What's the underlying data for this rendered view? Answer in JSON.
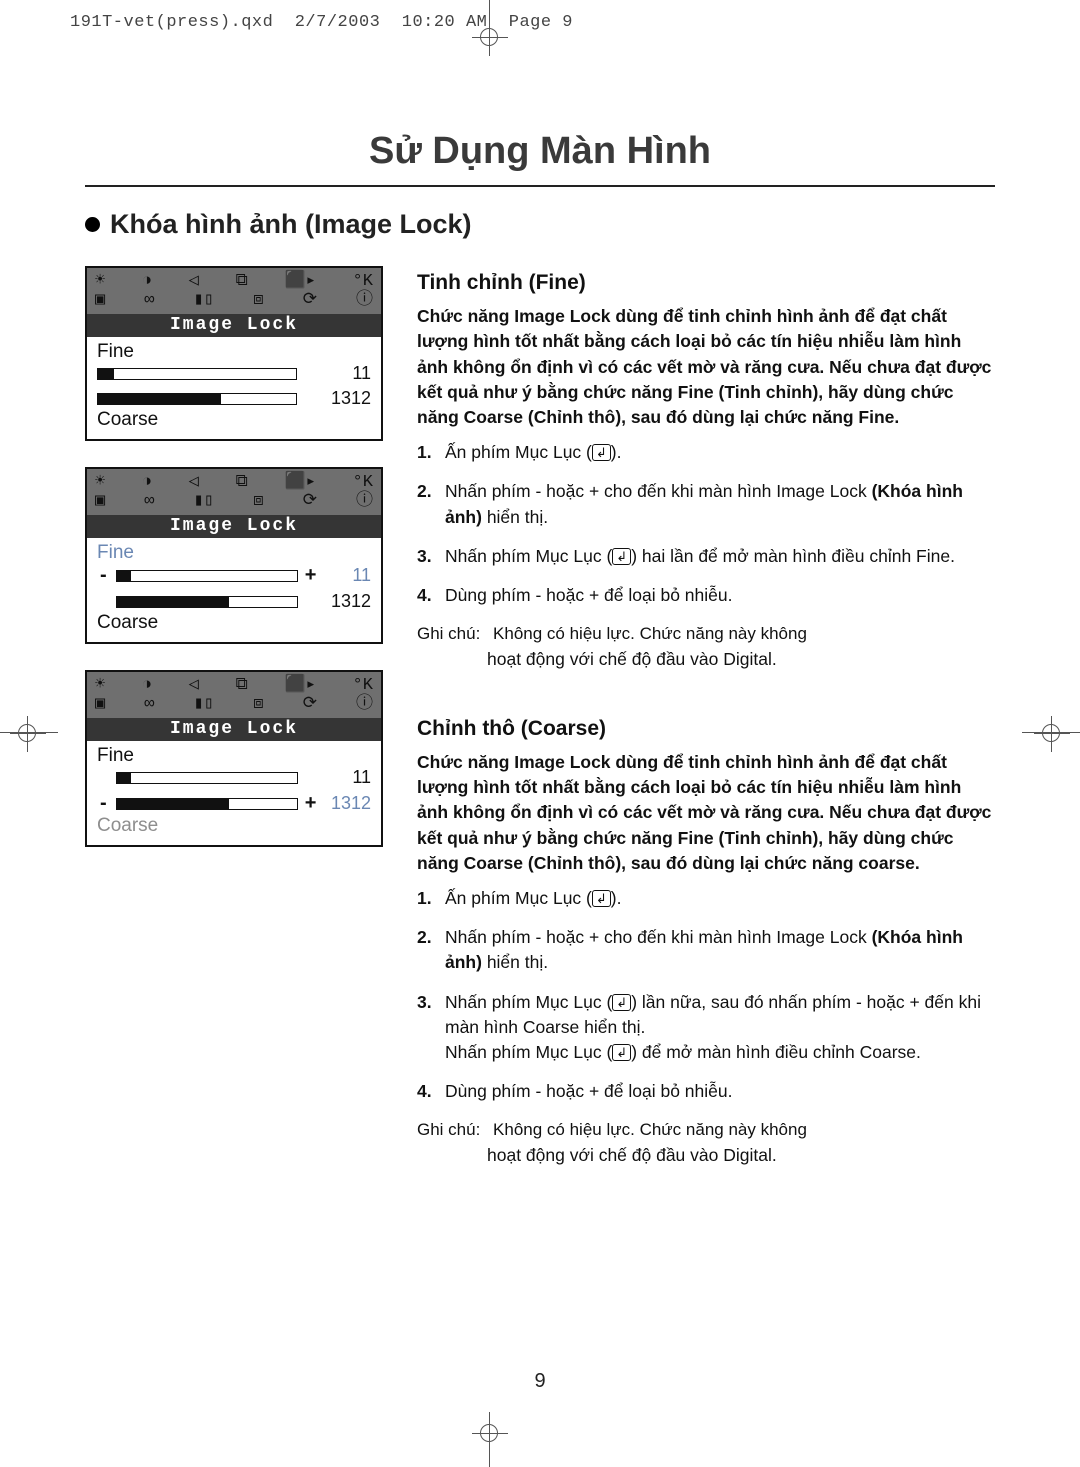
{
  "print_header": "191T-vet(press).qxd  2/7/2003  10:20 AM  Page 9",
  "main_title": "Sử Dụng Màn Hình",
  "subtitle": "Khóa hình ảnh (Image Lock)",
  "osd": {
    "title": "Image Lock",
    "icons_row1": [
      "☀",
      "◑",
      "◁",
      "⧉",
      "⬛▸",
      "°K"
    ],
    "icons_row2": [
      "▣",
      "∞",
      "▮▯",
      "⧈",
      "⟳",
      "ⓘ"
    ],
    "fine_label": "Fine",
    "coarse_label": "Coarse",
    "fine_value": "11",
    "coarse_value": "1312",
    "minus": "-",
    "plus": "+"
  },
  "fine": {
    "heading": "Tinh chỉnh (Fine)",
    "para": "Chức năng Image Lock dùng để tinh chỉnh hình ảnh để đạt chất lượng hình tốt nhất bằng cách loại bỏ các tín hiệu nhiễu làm hình ảnh không ổn định vì có các vết mờ và răng cưa. Nếu chưa đạt được kết quả như ý bằng chức năng Fine (Tinh chỉnh), hãy dùng chức năng Coarse (Chỉnh thô), sau đó dùng lại chức năng Fine.",
    "steps": {
      "n1": "1",
      "s1_a": "Ấn phím Mục Lục (",
      "s1_b": ").",
      "n2": "2",
      "s2_a": "Nhấn phím - hoặc + cho đến khi màn hình Image Lock ",
      "s2_bold": "(Khóa hình ảnh)",
      "s2_c": " hiển thị.",
      "n3": "3",
      "s3_a": "Nhấn phím Mục Lục (",
      "s3_b": ") hai lần để mở màn hình điều chỉnh Fine.",
      "n4": "4",
      "s4": "Dùng phím - hoặc + để loại bỏ nhiễu."
    },
    "note_label": "Ghi chú:",
    "note_1": "Không có hiệu lực. Chức năng này không",
    "note_2": "hoạt động với chế độ đầu vào Digital."
  },
  "coarse": {
    "heading": "Chỉnh thô (Coarse)",
    "para": "Chức năng Image Lock dùng để tinh chỉnh hình ảnh để đạt chất lượng hình tốt nhất bằng cách loại bỏ các tín hiệu nhiễu làm hình ảnh không ổn định vì có các vết mờ và răng cưa. Nếu chưa đạt được kết quả như ý bằng chức năng Fine (Tinh chỉnh), hãy dùng chức năng Coarse (Chỉnh thô), sau đó dùng lại chức năng coarse.",
    "steps": {
      "n1": "1",
      "s1_a": "Ấn phím Mục Lục (",
      "s1_b": ").",
      "n2": "2",
      "s2_a": "Nhấn phím - hoặc + cho đến khi màn hình Image Lock ",
      "s2_bold": "(Khóa hình ảnh)",
      "s2_c": " hiển thị.",
      "n3": "3",
      "s3_a": "Nhấn phím Mục Lục (",
      "s3_b": ") lần nữa, sau đó nhấn phím - hoặc + đến khi màn hình Coarse hiển thị.",
      "s3_c": "Nhấn phím Mục Lục (",
      "s3_d": ") để mở màn hình điều chỉnh Coarse.",
      "n4": "4",
      "s4": "Dùng phím - hoặc + để loại bỏ nhiễu."
    },
    "note_label": "Ghi chú:",
    "note_1": "Không có hiệu lực. Chức năng này không",
    "note_2": "hoạt động với chế độ đầu vào Digital."
  },
  "enter_glyph": "↲",
  "page_number": "9"
}
